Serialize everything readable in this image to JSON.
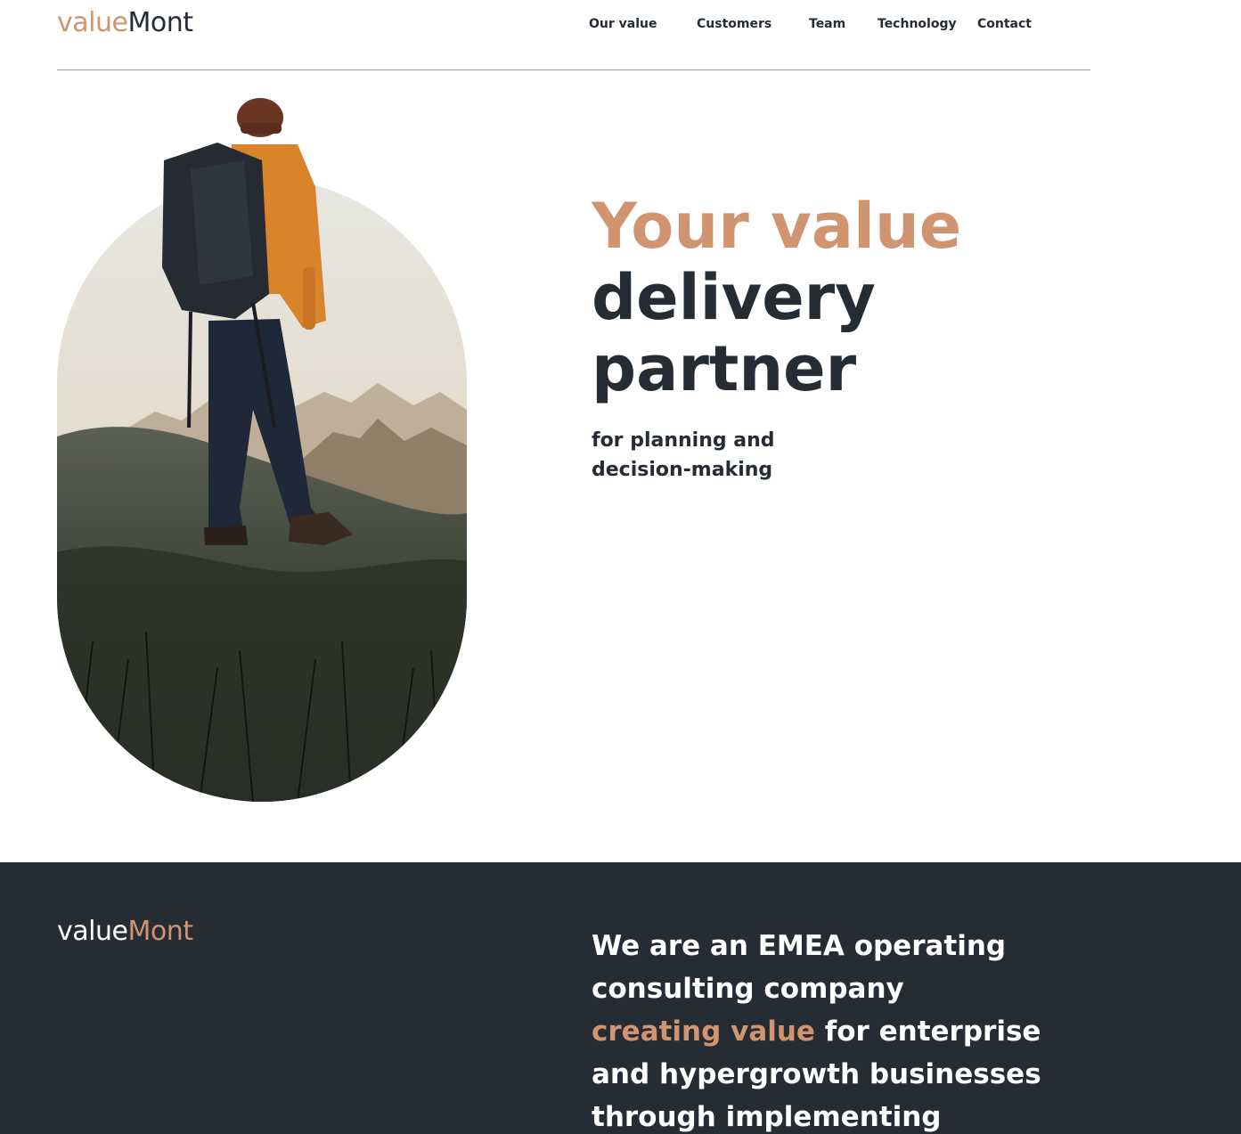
{
  "header": {
    "logo": {
      "part1": "value",
      "part2": "Mont"
    },
    "nav": [
      {
        "label": "Our value"
      },
      {
        "label": "Customers"
      },
      {
        "label": "Team"
      },
      {
        "label": "Technology"
      },
      {
        "label": "Contact"
      }
    ]
  },
  "hero": {
    "title_line1": "Your value",
    "title_line2": "delivery",
    "title_line3": "partner",
    "subtitle_line1": "for planning and",
    "subtitle_line2": "decision-making"
  },
  "about": {
    "logo": {
      "part1": "value",
      "part2": "Mont"
    },
    "line1": "We are an EMEA operating",
    "line2": "consulting company",
    "line3_highlight": "creating value",
    "line3_rest": " for enterprise",
    "line4": "and hypergrowth businesses",
    "line5": "through implementing"
  },
  "colors": {
    "accent": "#d09570",
    "dark": "#262c33",
    "background": "#ffffff"
  }
}
